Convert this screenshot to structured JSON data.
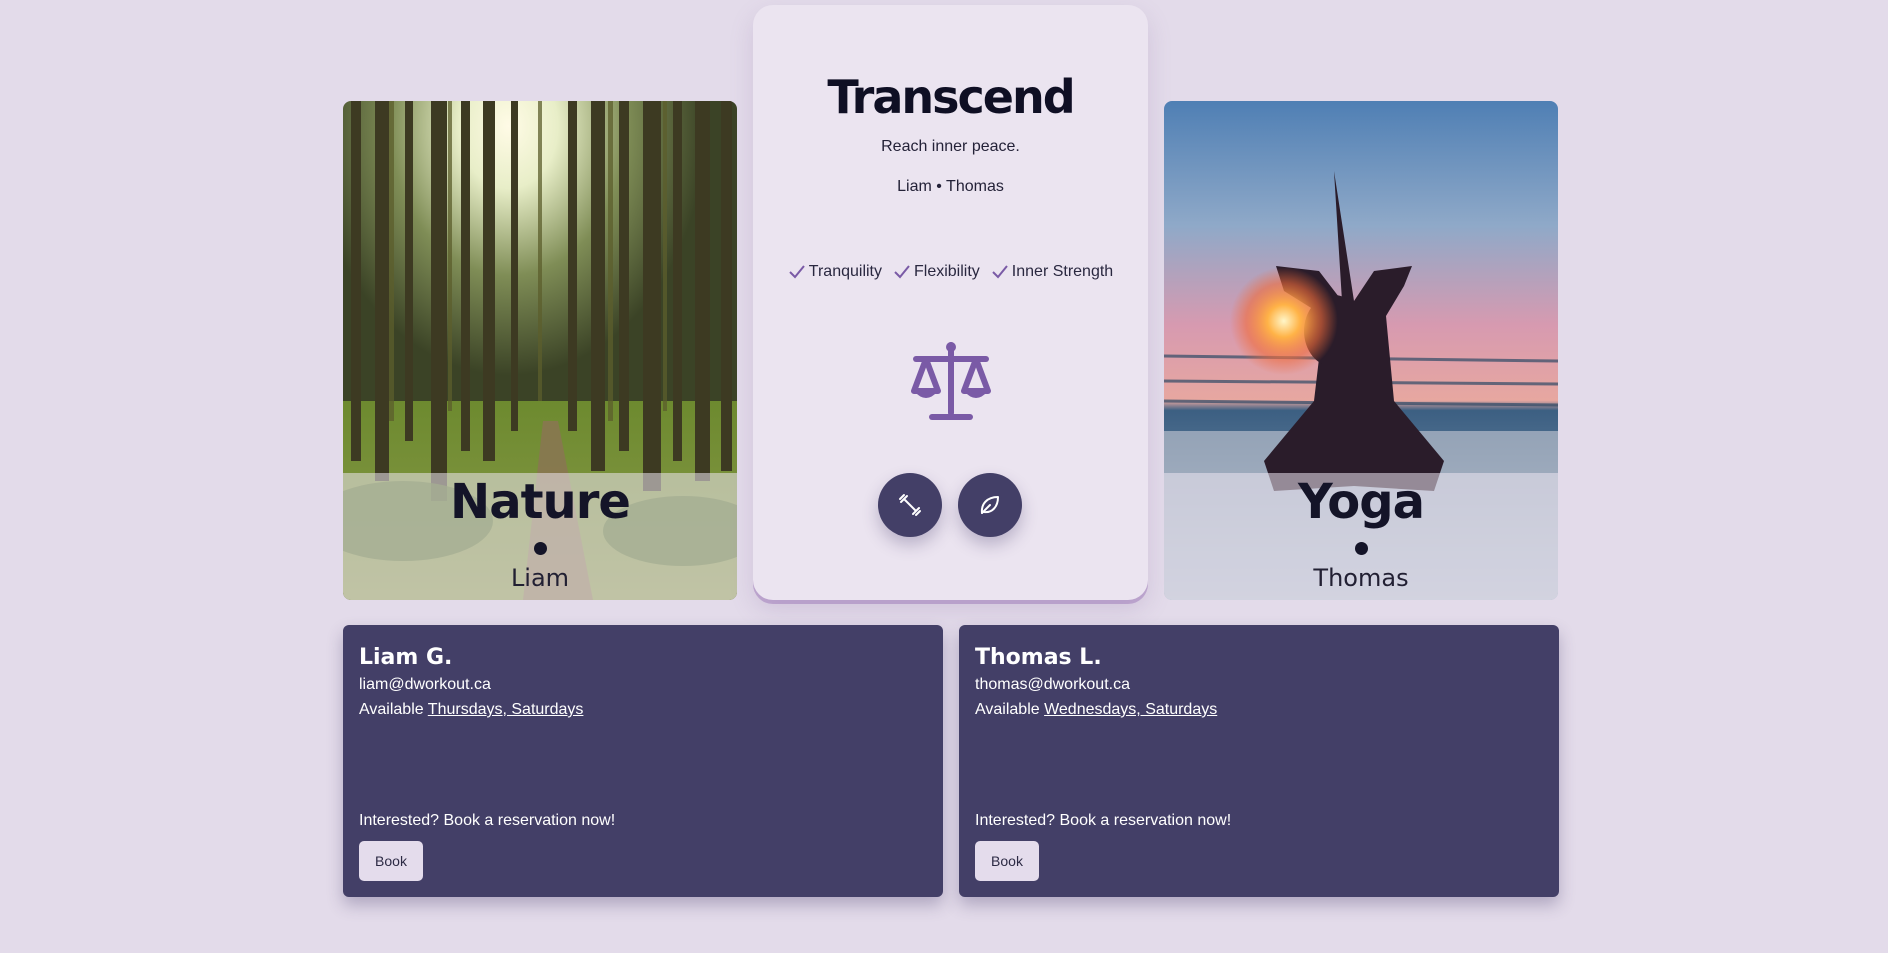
{
  "colors": {
    "page_background": "#e3dbea",
    "card_background": "#ebe4f0",
    "accent_purple": "#7a5aa6",
    "info_card_background": "#433f67",
    "button_background": "#e4dcec"
  },
  "left_card": {
    "title": "Nature",
    "separator": "•",
    "name": "Liam",
    "image": "forest-path-photo"
  },
  "right_card": {
    "title": "Yoga",
    "separator": "•",
    "name": "Thomas",
    "image": "yoga-sunset-beach-photo"
  },
  "center_card": {
    "title": "Transcend",
    "subtitle": "Reach inner peace.",
    "people": "Liam • Thomas",
    "features": [
      "Tranquility",
      "Flexibility",
      "Inner Strength"
    ],
    "main_icon": "scale-balance-icon",
    "buttons": [
      {
        "icon": "dumbbell-icon"
      },
      {
        "icon": "leaf-icon"
      }
    ]
  },
  "trainers": [
    {
      "name": "Liam G.",
      "email": "liam@dworkout.ca",
      "available_label": "Available",
      "available_days": "Thursdays, Saturdays",
      "cta": "Interested? Book a reservation now!",
      "book_label": "Book"
    },
    {
      "name": "Thomas L.",
      "email": "thomas@dworkout.ca",
      "available_label": "Available",
      "available_days": "Wednesdays, Saturdays",
      "cta": "Interested? Book a reservation now!",
      "book_label": "Book"
    }
  ]
}
